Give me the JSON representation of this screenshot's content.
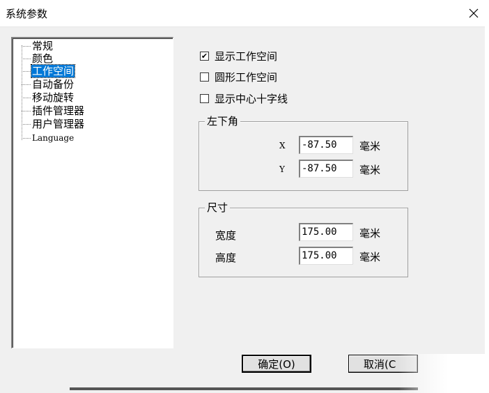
{
  "window": {
    "title": "系统参数"
  },
  "tree": {
    "items": [
      {
        "label": "常规"
      },
      {
        "label": "颜色"
      },
      {
        "label": "工作空间",
        "selected": true
      },
      {
        "label": "自动备份"
      },
      {
        "label": "移动旋转"
      },
      {
        "label": "插件管理器"
      },
      {
        "label": "用户管理器"
      },
      {
        "label": "Language"
      }
    ]
  },
  "options": {
    "show_workspace": {
      "label": "显示工作空间",
      "checked": true,
      "mark": "✔"
    },
    "round_workspace": {
      "label": "圆形工作空间",
      "checked": false
    },
    "show_crosshair": {
      "label": "显示中心十字线",
      "checked": false
    }
  },
  "lower_left": {
    "title": "左下角",
    "x": {
      "label": "X",
      "value": "-87.50",
      "unit": "毫米"
    },
    "y": {
      "label": "Y",
      "value": "-87.50",
      "unit": "毫米"
    }
  },
  "size": {
    "title": "尺寸",
    "width": {
      "label": "宽度",
      "value": "175.00",
      "unit": "毫米"
    },
    "height": {
      "label": "高度",
      "value": "175.00",
      "unit": "毫米"
    }
  },
  "buttons": {
    "ok": "确定(O)",
    "cancel": "取消(C"
  }
}
